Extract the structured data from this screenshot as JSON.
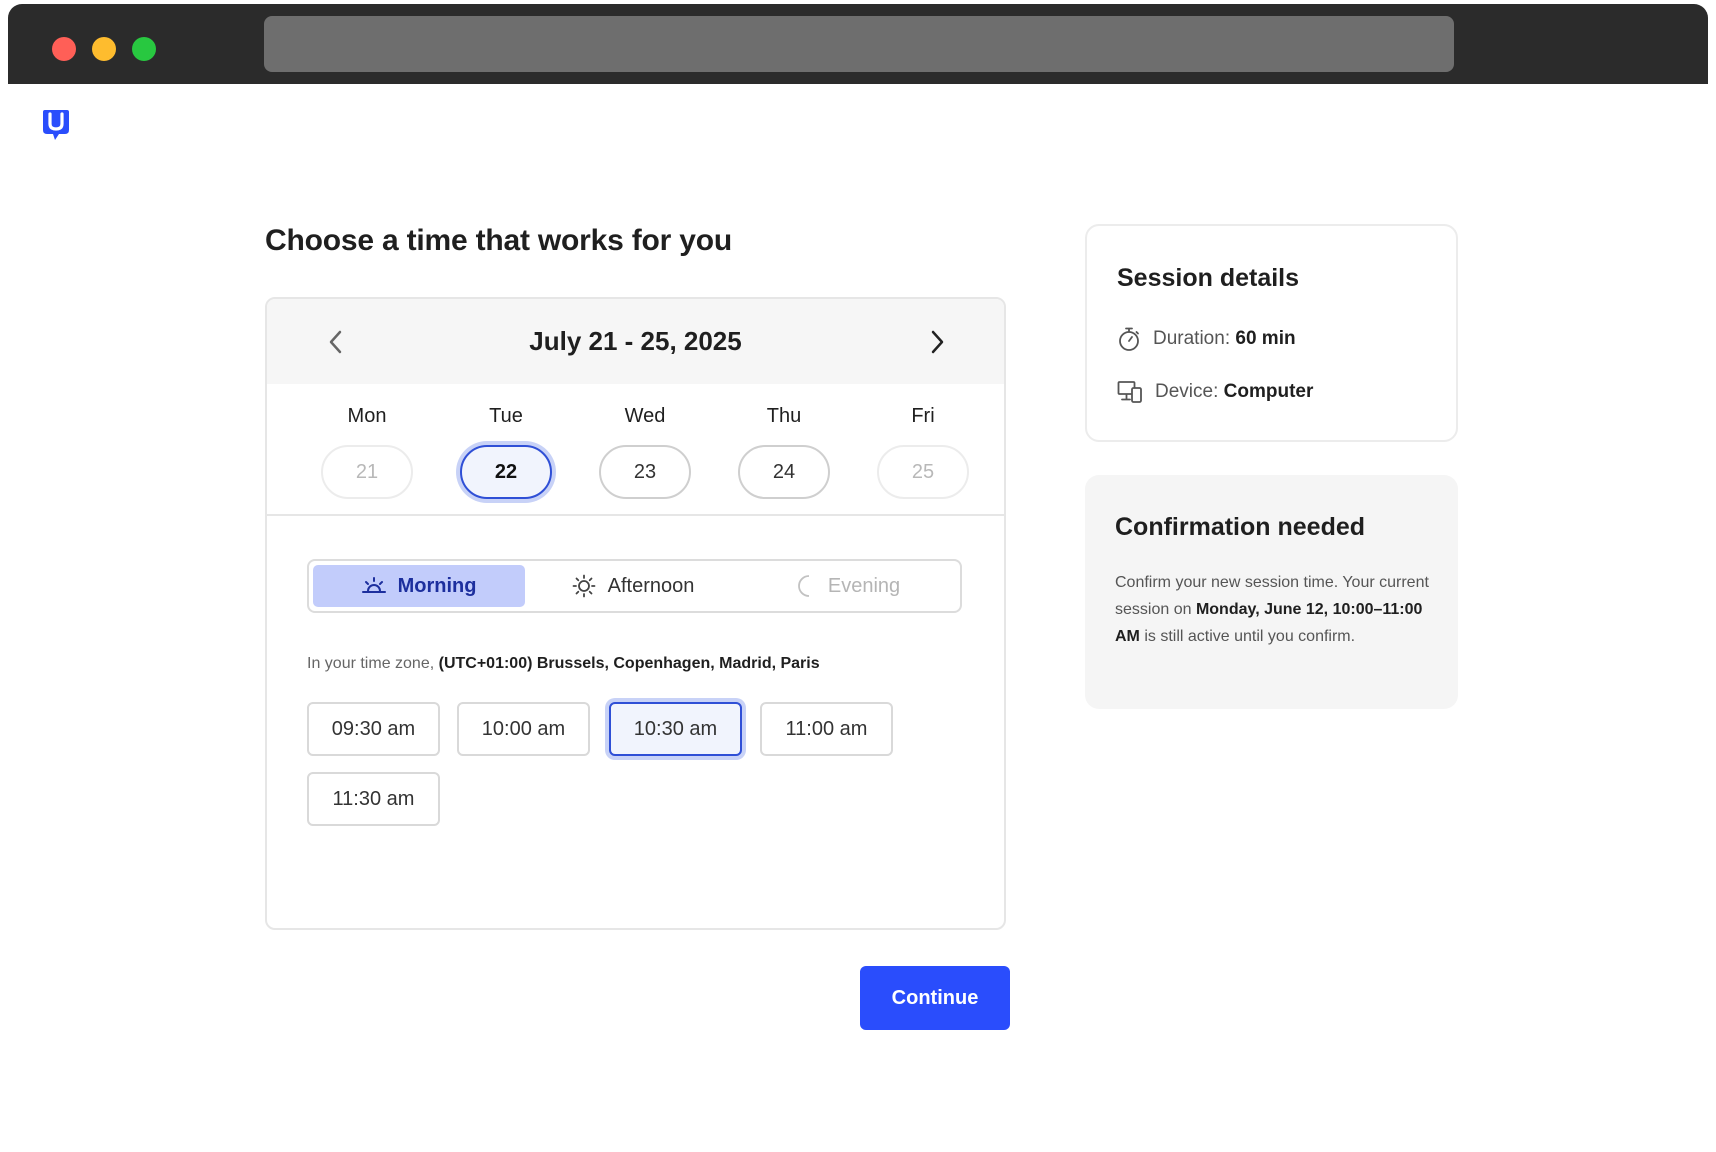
{
  "page": {
    "title": "Choose a time that works for you"
  },
  "calendar": {
    "week_range": "July 21 - 25, 2025",
    "days": [
      {
        "name": "Mon",
        "date": "21",
        "state": "disabled"
      },
      {
        "name": "Tue",
        "date": "22",
        "state": "selected"
      },
      {
        "name": "Wed",
        "date": "23",
        "state": "available"
      },
      {
        "name": "Thu",
        "date": "24",
        "state": "available"
      },
      {
        "name": "Fri",
        "date": "25",
        "state": "disabled"
      }
    ],
    "periods": [
      {
        "label": "Morning",
        "icon": "sunrise-icon",
        "state": "selected"
      },
      {
        "label": "Afternoon",
        "icon": "sun-icon",
        "state": "available"
      },
      {
        "label": "Evening",
        "icon": "moon-icon",
        "state": "disabled"
      }
    ],
    "timezone_prefix": "In your time zone, ",
    "timezone": "(UTC+01:00) Brussels, Copenhagen, Madrid, Paris",
    "slots": [
      {
        "label": "09:30 am",
        "state": "available"
      },
      {
        "label": "10:00 am",
        "state": "available"
      },
      {
        "label": "10:30 am",
        "state": "selected"
      },
      {
        "label": "11:00 am",
        "state": "available"
      },
      {
        "label": "11:30 am",
        "state": "available"
      }
    ]
  },
  "actions": {
    "continue_label": "Continue"
  },
  "session": {
    "title": "Session details",
    "duration_label": "Duration:",
    "duration_value": "60 min",
    "device_label": "Device:",
    "device_value": "Computer"
  },
  "confirmation": {
    "title": "Confirmation needed",
    "text_1": "Confirm your new session time. Your current session on ",
    "text_bold": "Monday, June 12, 10:00–11:00 AM",
    "text_2": " is still active until you confirm."
  },
  "colors": {
    "accent": "#2a4dfc",
    "selected_border": "#2f4fd6",
    "selected_tab_bg": "#c2ccfb",
    "chrome": "#2b2b2b"
  }
}
